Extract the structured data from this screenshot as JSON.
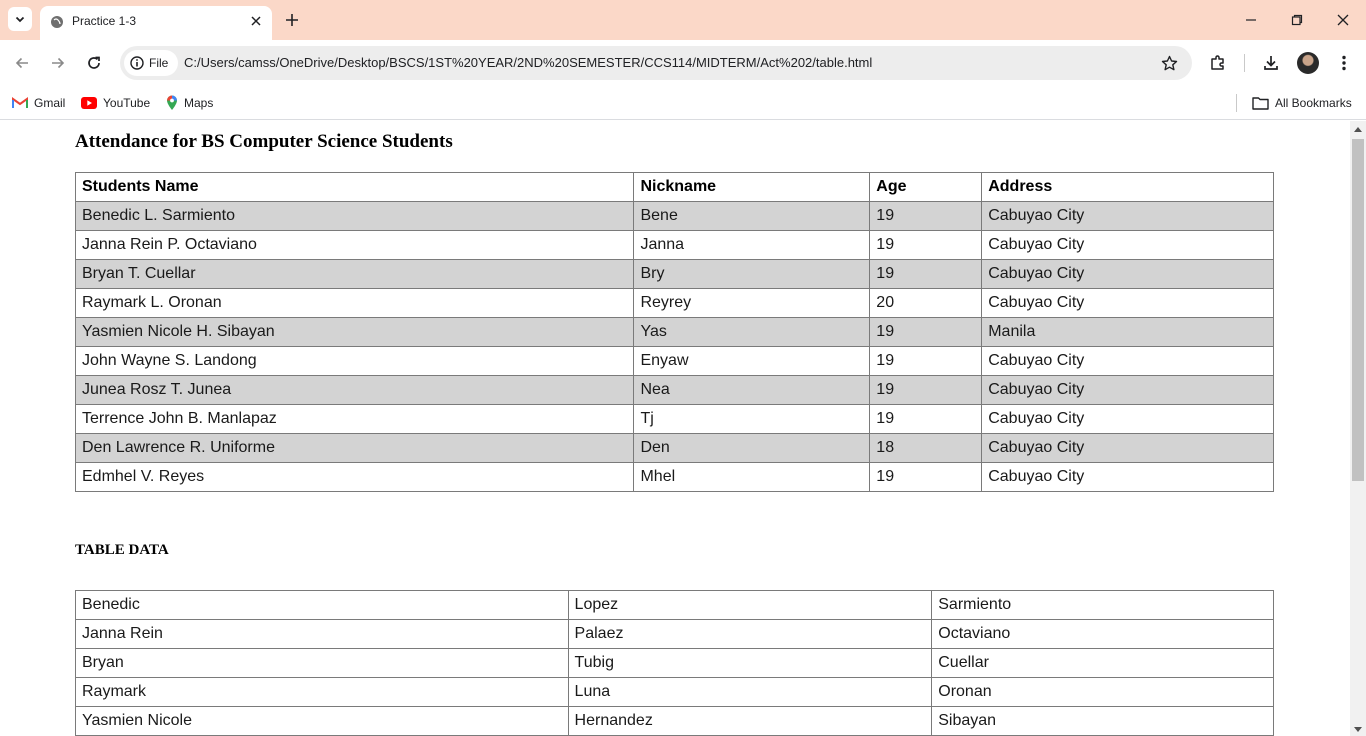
{
  "browser": {
    "tab": {
      "title": "Practice 1-3"
    },
    "address": {
      "chip_label": "File",
      "url": "C:/Users/camss/OneDrive/Desktop/BSCS/1ST%20YEAR/2ND%20SEMESTER/CCS114/MIDTERM/Act%202/table.html"
    },
    "bookmarks": [
      {
        "label": "Gmail",
        "icon": "gmail-icon"
      },
      {
        "label": "YouTube",
        "icon": "youtube-icon"
      },
      {
        "label": "Maps",
        "icon": "maps-icon"
      }
    ],
    "all_bookmarks_label": "All Bookmarks"
  },
  "page": {
    "title": "Attendance for BS Computer Science Students",
    "attendance_table": {
      "headers": [
        "Students Name",
        "Nickname",
        "Age",
        "Address"
      ],
      "rows": [
        [
          "Benedic L. Sarmiento",
          "Bene",
          "19",
          "Cabuyao City"
        ],
        [
          "Janna Rein P. Octaviano",
          "Janna",
          "19",
          "Cabuyao City"
        ],
        [
          "Bryan T. Cuellar",
          "Bry",
          "19",
          "Cabuyao City"
        ],
        [
          "Raymark L. Oronan",
          "Reyrey",
          "20",
          "Cabuyao City"
        ],
        [
          "Yasmien Nicole H. Sibayan",
          "Yas",
          "19",
          "Manila"
        ],
        [
          "John Wayne S. Landong",
          "Enyaw",
          "19",
          "Cabuyao City"
        ],
        [
          "Junea Rosz T. Junea",
          "Nea",
          "19",
          "Cabuyao City"
        ],
        [
          "Terrence John B. Manlapaz",
          "Tj",
          "19",
          "Cabuyao City"
        ],
        [
          "Den Lawrence R. Uniforme",
          "Den",
          "18",
          "Cabuyao City"
        ],
        [
          "Edmhel V. Reyes",
          "Mhel",
          "19",
          "Cabuyao City"
        ]
      ]
    },
    "section_title": "TABLE DATA",
    "data_table": {
      "rows": [
        [
          "Benedic",
          "Lopez",
          "Sarmiento"
        ],
        [
          "Janna Rein",
          "Palaez",
          "Octaviano"
        ],
        [
          "Bryan",
          "Tubig",
          "Cuellar"
        ],
        [
          "Raymark",
          "Luna",
          "Oronan"
        ],
        [
          "Yasmien Nicole",
          "Hernandez",
          "Sibayan"
        ]
      ]
    }
  },
  "colors": {
    "tabstrip": "#fbd8c8",
    "striped_row": "#d3d3d3",
    "omnibox": "#ededed"
  }
}
